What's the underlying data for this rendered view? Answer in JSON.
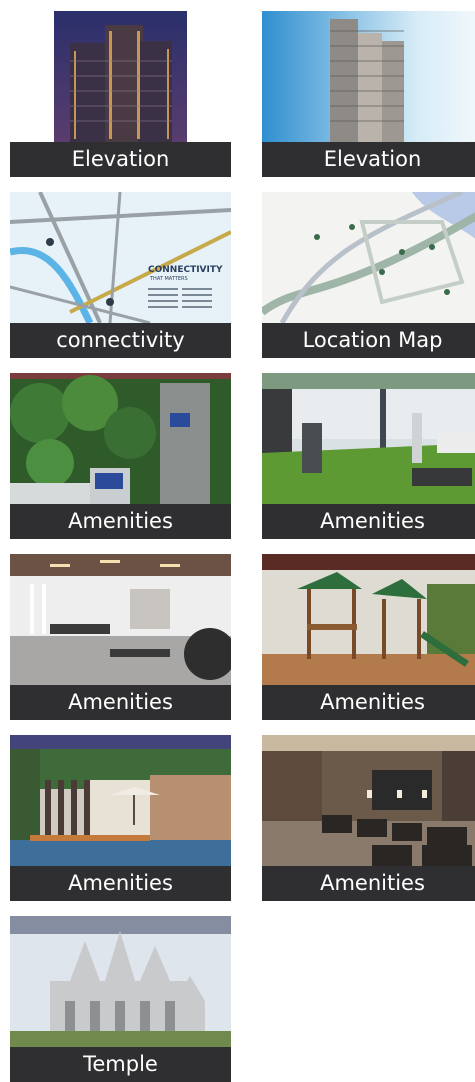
{
  "gallery": {
    "items": [
      {
        "caption": "Elevation",
        "icon": "tower-night-photo"
      },
      {
        "caption": "Elevation",
        "icon": "tower-day-photo"
      },
      {
        "caption": "connectivity",
        "icon": "connectivity-map-image"
      },
      {
        "caption": "Location Map",
        "icon": "location-map-image"
      },
      {
        "caption": "Amenities",
        "icon": "aerial-garden-photo"
      },
      {
        "caption": "Amenities",
        "icon": "outdoor-gym-photo"
      },
      {
        "caption": "Amenities",
        "icon": "indoor-gym-photo"
      },
      {
        "caption": "Amenities",
        "icon": "kids-play-area-photo"
      },
      {
        "caption": "Amenities",
        "icon": "poolside-deck-photo"
      },
      {
        "caption": "Amenities",
        "icon": "mini-theatre-photo"
      },
      {
        "caption": "Temple",
        "icon": "temple-photo"
      }
    ],
    "connectivity_banner": {
      "title": "CONNECTIVITY",
      "subtitle": "THAT MATTERS"
    }
  }
}
